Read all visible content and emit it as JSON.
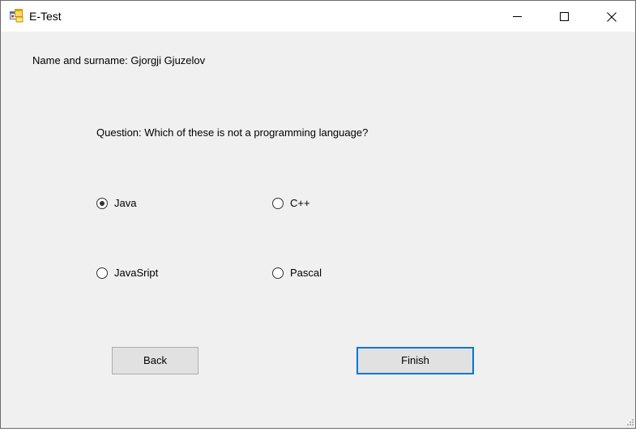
{
  "window": {
    "title": "E-Test",
    "icon": "app-window-icon",
    "controls": [
      "minimize-icon",
      "maximize-icon",
      "close-icon"
    ]
  },
  "form": {
    "name_label": "Name and surname:  Gjorgji Gjuzelov",
    "question_label": "Question:  Which of these is not a programming language?",
    "options": [
      {
        "label": "Java",
        "selected": true
      },
      {
        "label": "C++",
        "selected": false
      },
      {
        "label": "JavaSript",
        "selected": false
      },
      {
        "label": "Pascal",
        "selected": false
      }
    ],
    "buttons": {
      "back": "Back",
      "finish": "Finish"
    }
  },
  "colors": {
    "focus_border": "#0078d7",
    "client_background": "#f0f0f0",
    "button_face": "#e1e1e1"
  }
}
